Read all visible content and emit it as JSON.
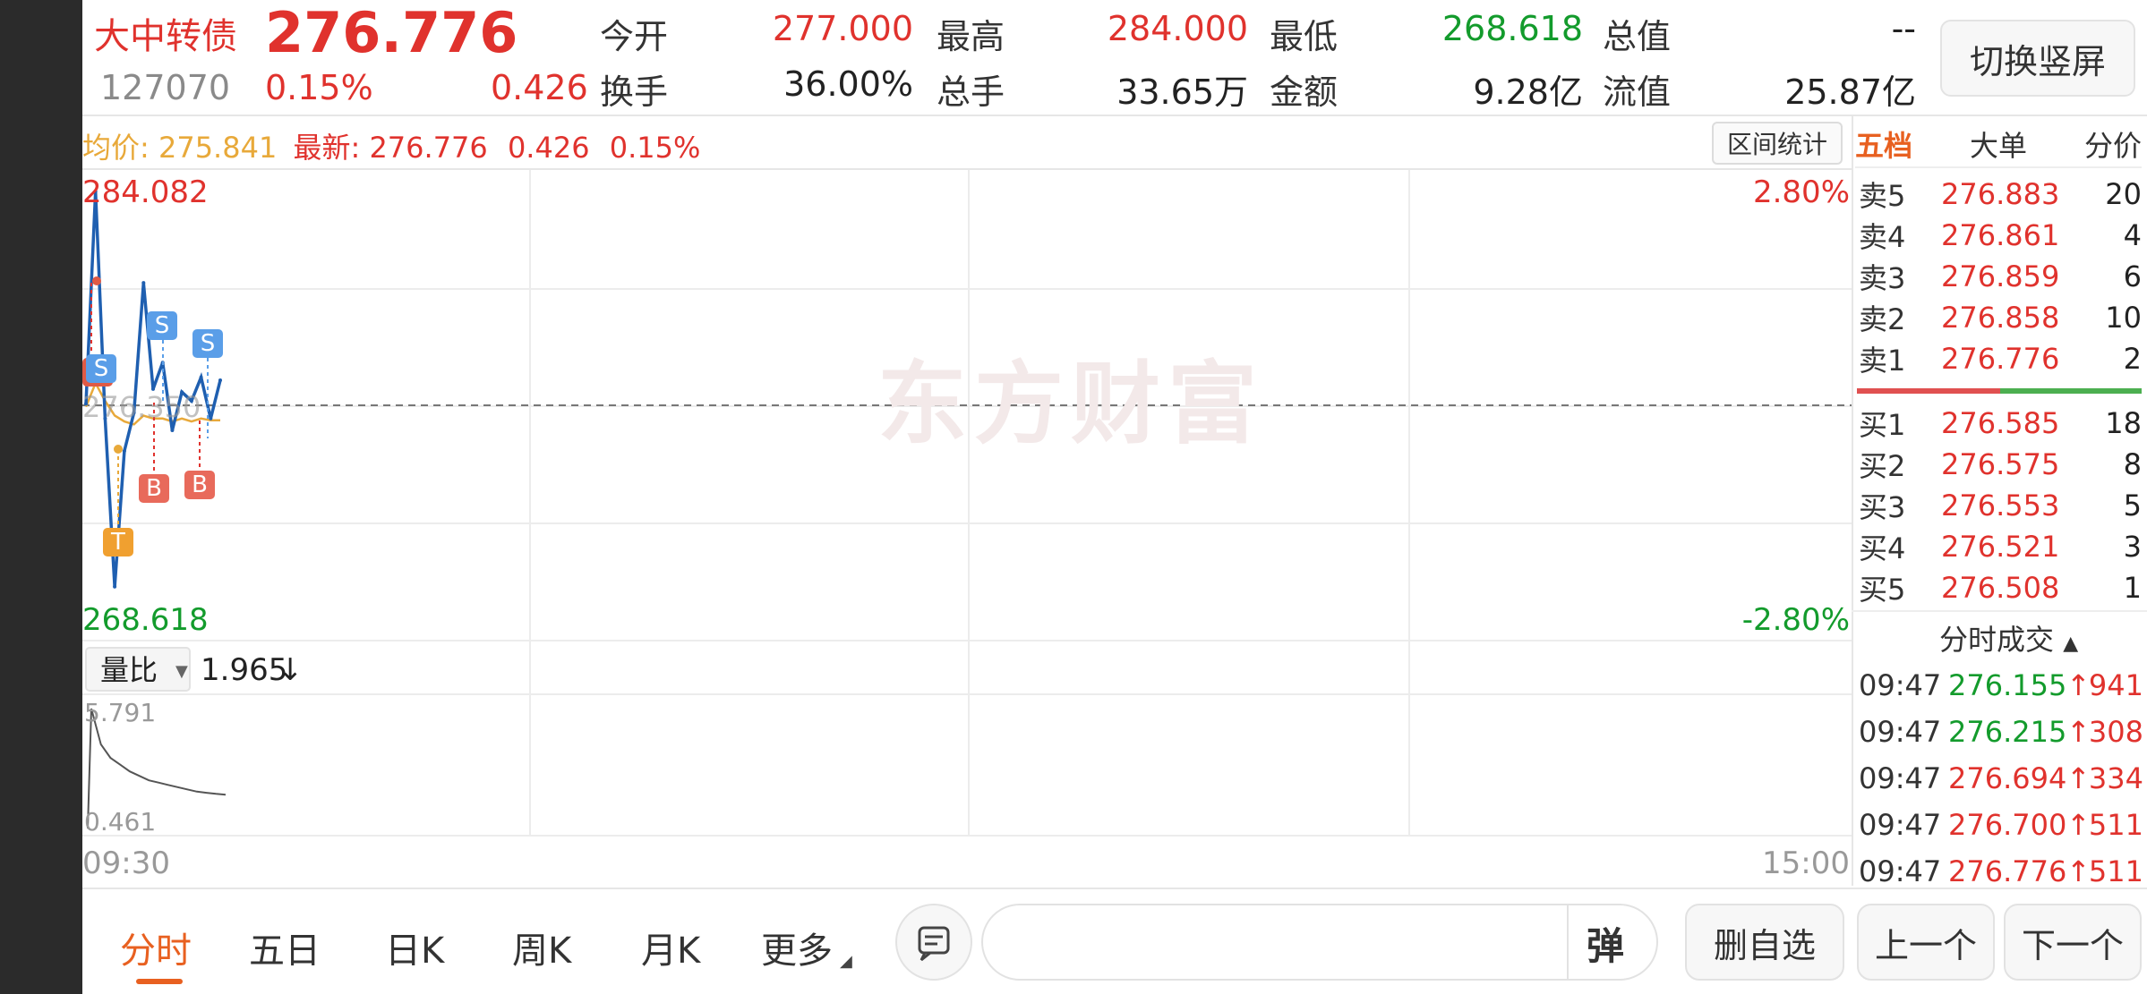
{
  "header": {
    "name": "大中转债",
    "price": "276.776",
    "code": "127070",
    "pct": "0.15%",
    "change": "0.426",
    "stats": [
      {
        "label": "今开",
        "value": "277.000",
        "color": "red"
      },
      {
        "label": "最高",
        "value": "284.000",
        "color": "red"
      },
      {
        "label": "最低",
        "value": "268.618",
        "color": "green"
      },
      {
        "label": "总值",
        "value": "--",
        "color": "black"
      },
      {
        "label": "换手",
        "value": "36.00%",
        "color": "black"
      },
      {
        "label": "总手",
        "value": "33.65万",
        "color": "black"
      },
      {
        "label": "金额",
        "value": "9.28亿",
        "color": "black"
      },
      {
        "label": "流值",
        "value": "25.87亿",
        "color": "black"
      }
    ],
    "switch_label": "切换竖屏"
  },
  "chart": {
    "avg_label": "均价:",
    "avg_value": "275.841",
    "latest_label": "最新:",
    "latest_value": "276.776",
    "latest_change": "0.426",
    "latest_pct": "0.15%",
    "range_button": "区间统计",
    "y_high": "284.082",
    "y_low": "268.618",
    "pct_high": "2.80%",
    "pct_low": "-2.80%",
    "y_mid": "276.350",
    "watermark": "东方财富",
    "ratio_label": "量比",
    "ratio_value": "1.965",
    "ratio_arrow": "↓",
    "vol_high": "5.791",
    "vol_low": "0.461",
    "time_start": "09:30",
    "time_end": "15:00",
    "markers": {
      "s": "S",
      "b": "B",
      "t": "T"
    }
  },
  "chart_data": {
    "type": "line",
    "x_range": [
      "09:30",
      "15:00"
    ],
    "ylim": [
      268.618,
      284.082
    ],
    "series": [
      {
        "values": [
          276.4,
          283.6,
          275.9,
          270.2,
          274.8,
          276.1,
          280.5,
          276.9,
          277.8,
          275.5,
          276.8,
          276.5,
          277.3,
          275.9,
          277.2
        ]
      },
      {
        "values": [
          276.3,
          277.1,
          276.5,
          276.0,
          275.8,
          275.7,
          276.0,
          275.9,
          275.9,
          275.8,
          275.9,
          275.8,
          275.9,
          275.84,
          275.84
        ]
      }
    ],
    "volume_ratio": {
      "ylim": [
        0.461,
        5.791
      ],
      "values": [
        5.791,
        4.2,
        3.6,
        3.3,
        3.0,
        2.8,
        2.6,
        2.5,
        2.4,
        2.3,
        2.2,
        2.1,
        2.05,
        2.0,
        1.965
      ]
    }
  },
  "panel": {
    "tabs": [
      "五档",
      "大单",
      "分价"
    ],
    "asks": [
      {
        "label": "卖5",
        "price": "276.883",
        "vol": "20"
      },
      {
        "label": "卖4",
        "price": "276.861",
        "vol": "4"
      },
      {
        "label": "卖3",
        "price": "276.859",
        "vol": "6"
      },
      {
        "label": "卖2",
        "price": "276.858",
        "vol": "10"
      },
      {
        "label": "卖1",
        "price": "276.776",
        "vol": "2"
      }
    ],
    "bids": [
      {
        "label": "买1",
        "price": "276.585",
        "vol": "18"
      },
      {
        "label": "买2",
        "price": "276.575",
        "vol": "8"
      },
      {
        "label": "买3",
        "price": "276.553",
        "vol": "5"
      },
      {
        "label": "买4",
        "price": "276.521",
        "vol": "3"
      },
      {
        "label": "买5",
        "price": "276.508",
        "vol": "1"
      }
    ],
    "trades_title": "分时成交",
    "trades": [
      {
        "time": "09:47",
        "price": "276.155",
        "arrow": "↑",
        "vol": "941"
      },
      {
        "time": "09:47",
        "price": "276.215",
        "arrow": "↑",
        "vol": "308"
      },
      {
        "time": "09:47",
        "price": "276.694",
        "arrow": "↑",
        "vol": "334"
      },
      {
        "time": "09:47",
        "price": "276.700",
        "arrow": "↑",
        "vol": "511"
      },
      {
        "time": "09:47",
        "price": "276.776",
        "arrow": "↑",
        "vol": "511"
      }
    ]
  },
  "bottom": {
    "tabs": [
      "分时",
      "五日",
      "日K",
      "周K",
      "月K",
      "更多"
    ],
    "danmu": "弹",
    "delete_fav": "删自选",
    "prev": "上一个",
    "next": "下一个"
  },
  "colors": {
    "red": "#e0322d",
    "green": "#139b2c",
    "price_line": "#1f5fb0",
    "avg_line": "#e8a93a"
  }
}
